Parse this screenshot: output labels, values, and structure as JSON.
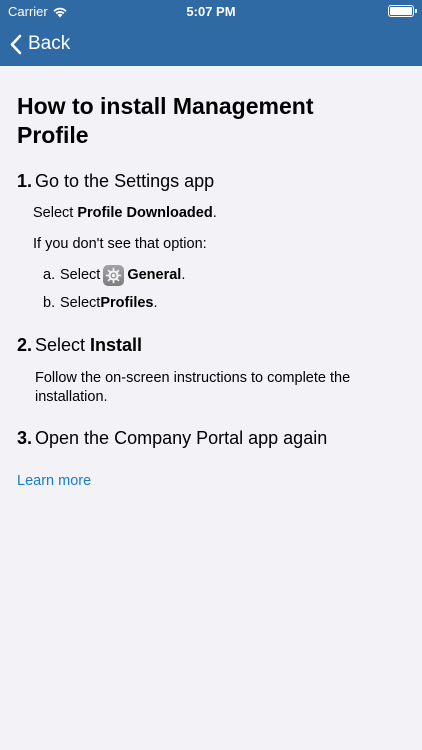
{
  "status": {
    "carrier": "Carrier",
    "time": "5:07 PM"
  },
  "nav": {
    "back_label": "Back"
  },
  "page": {
    "title": "How to install Management Profile"
  },
  "steps": [
    {
      "number": "1.",
      "title": "Go to the Settings app",
      "instruction_prefix": "Select ",
      "instruction_bold": "Profile Downloaded",
      "instruction_suffix": ".",
      "fallback": "If you don't see that option:",
      "substeps": [
        {
          "letter": "a.",
          "prefix": "Select ",
          "bold": "General",
          "suffix": ".",
          "icon": "gear-icon"
        },
        {
          "letter": "b.",
          "prefix": "Select ",
          "bold": "Profiles",
          "suffix": "."
        }
      ]
    },
    {
      "number": "2.",
      "title_prefix": "Select ",
      "title_bold": "Install",
      "description": "Follow the on-screen instructions to complete the installation."
    },
    {
      "number": "3.",
      "title": "Open the Company Portal app again"
    }
  ],
  "learn_more": "Learn more",
  "colors": {
    "nav_bg": "#2f6aa4",
    "link": "#1a7ccc",
    "background": "#f2f2f7"
  }
}
